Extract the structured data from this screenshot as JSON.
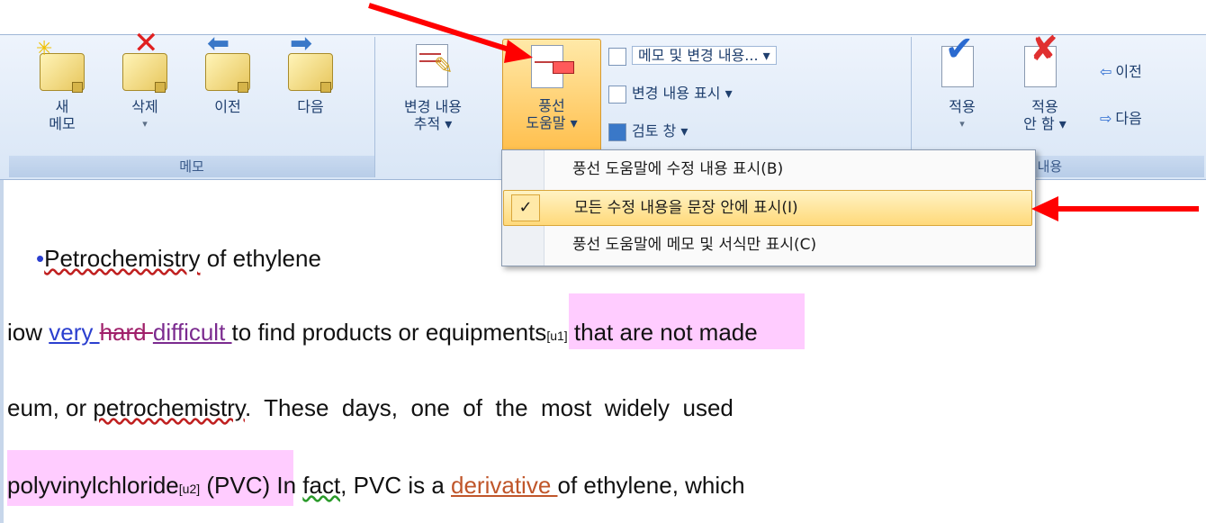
{
  "caption": "",
  "ribbon": {
    "memo_group": {
      "label": "메모",
      "new_memo": [
        "새",
        "메모"
      ],
      "delete": "삭제",
      "prev": "이전",
      "next": "다음"
    },
    "tracking_group": {
      "track_changes": [
        "변경 내용",
        "추적 ▾"
      ],
      "balloon": [
        "풍선",
        "도움말 ▾"
      ],
      "show_markup_combo": "메모 및 변경 내용... ▾",
      "show_changes": "변경 내용 표시 ▾",
      "review_pane": "검토 창 ▾"
    },
    "changes_group": {
      "label": "경 내용",
      "accept": [
        "적용"
      ],
      "reject": [
        "적용",
        "안 함 ▾"
      ],
      "prev": "이전",
      "next": "다음"
    }
  },
  "balloon_menu": {
    "items": [
      {
        "label": "풍선 도움말에 수정 내용 표시(B)",
        "checked": false
      },
      {
        "label": "모든 수정 내용을 문장 안에 표시(I)",
        "checked": true
      },
      {
        "label": "풍선 도움말에 메모 및 서식만 표시(C)",
        "checked": false
      }
    ]
  },
  "document": {
    "bullet_heading": {
      "word1": "Petrochemistry",
      "rest": " of ethylene"
    },
    "line2": {
      "a": "iow ",
      "ins1": "very ",
      "del1": "hard ",
      "ins2": "difficult ",
      "b": "to find products or ",
      "comment": "equipments",
      "ref": "[u1]",
      "c": " that are not made"
    },
    "line3": {
      "a": "eum, or ",
      "sq": "petrochemistry",
      "b": ".  These  days,  one  of  the  most  widely  used"
    },
    "line4": {
      "comment": "polyvinylchloride",
      "ref": "[u2]",
      "a": " (PVC) In ",
      "sq": "fact,",
      "b": " PVC is a ",
      "ins": "derivative ",
      "c": "of ethylene, which"
    }
  },
  "colors": {
    "highlight": "#ffbf4d",
    "arrow": "#ff0000",
    "insertion": "#2b3fcf",
    "deletion": "#a0206a",
    "comment_bg": "#ffccff"
  }
}
